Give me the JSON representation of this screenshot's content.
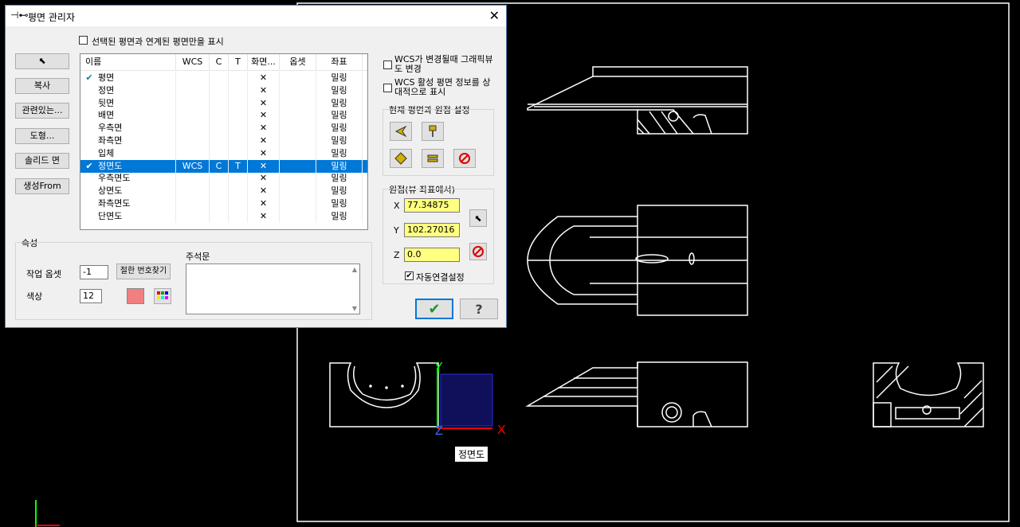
{
  "dialog": {
    "title": "평면 관리자",
    "filter_checkbox": "선택된 평면과 연계된 평면만을 표시",
    "left_buttons": [
      "",
      "복사",
      "관련있는...",
      "도형...",
      "솔리드 면",
      "생성From"
    ],
    "table": {
      "headers": [
        "이름",
        "WCS",
        "C",
        "T",
        "화면...",
        "옵셋",
        "좌표"
      ],
      "rows": [
        {
          "check": "✔",
          "name": "평면",
          "wcs": "",
          "c": "",
          "t": "",
          "screen": "✕",
          "offset": "",
          "coord": "밀링"
        },
        {
          "check": "",
          "name": "정면",
          "wcs": "",
          "c": "",
          "t": "",
          "screen": "✕",
          "offset": "",
          "coord": "밀링"
        },
        {
          "check": "",
          "name": "뒷면",
          "wcs": "",
          "c": "",
          "t": "",
          "screen": "✕",
          "offset": "",
          "coord": "밀링"
        },
        {
          "check": "",
          "name": "배면",
          "wcs": "",
          "c": "",
          "t": "",
          "screen": "✕",
          "offset": "",
          "coord": "밀링"
        },
        {
          "check": "",
          "name": "우측면",
          "wcs": "",
          "c": "",
          "t": "",
          "screen": "✕",
          "offset": "",
          "coord": "밀링"
        },
        {
          "check": "",
          "name": "좌측면",
          "wcs": "",
          "c": "",
          "t": "",
          "screen": "✕",
          "offset": "",
          "coord": "밀링"
        },
        {
          "check": "",
          "name": "입체",
          "wcs": "",
          "c": "",
          "t": "",
          "screen": "✕",
          "offset": "",
          "coord": "밀링"
        },
        {
          "check": "✔",
          "name": "정면도",
          "wcs": "WCS",
          "c": "C",
          "t": "T",
          "screen": "✕",
          "offset": "",
          "coord": "밀링"
        },
        {
          "check": "",
          "name": "우측면도",
          "wcs": "",
          "c": "",
          "t": "",
          "screen": "✕",
          "offset": "",
          "coord": "밀링"
        },
        {
          "check": "",
          "name": "상면도",
          "wcs": "",
          "c": "",
          "t": "",
          "screen": "✕",
          "offset": "",
          "coord": "밀링"
        },
        {
          "check": "",
          "name": "좌측면도",
          "wcs": "",
          "c": "",
          "t": "",
          "screen": "✕",
          "offset": "",
          "coord": "밀링"
        },
        {
          "check": "",
          "name": "단면도",
          "wcs": "",
          "c": "",
          "t": "",
          "screen": "✕",
          "offset": "",
          "coord": "밀링"
        }
      ],
      "selected_index": 7
    },
    "properties": {
      "title": "속성",
      "offset_label": "작업 옵셋",
      "offset_value": "-1",
      "find_button": "절한 번호찾기",
      "color_label": "색상",
      "color_value": "12",
      "color_swatch": "#f08080",
      "comment_label": "주석문"
    },
    "right": {
      "wcs_graphic_cb": "WCS가 변경될때 그래픽뷰도 변경",
      "wcs_active_cb": "WCS 활성 평면 정보를 상대적으로 표시",
      "current_group_title": "현재 평면과 원점 설정",
      "origin_group_title": "원점(뷰 좌표에서)",
      "x_label": "X",
      "x_value": "77.34875",
      "y_label": "Y",
      "y_value": "102.27016",
      "z_label": "Z",
      "z_value": "0.0",
      "auto_link_cb": "자동연결설정",
      "auto_link_checked": "✔"
    }
  },
  "viewport": {
    "axis_x": "X",
    "axis_y": "Y",
    "axis_z": "Z",
    "tooltip": "정면도"
  }
}
